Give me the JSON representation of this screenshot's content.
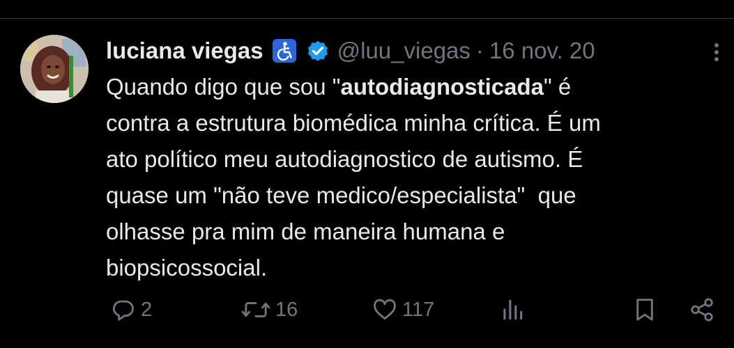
{
  "tweet": {
    "author": {
      "display_name": "luciana viegas",
      "handle": "@luu_viegas",
      "badges": [
        "accessibility-icon",
        "verified-badge-icon"
      ]
    },
    "separator": "·",
    "date": "16 nov. 20",
    "text_lines": [
      {
        "before": "Quando digo que sou \"",
        "bold": "autodiagnosticada",
        "after": "\" é"
      },
      {
        "text": "contra a estrutura biomédica minha crítica. É um"
      },
      {
        "text": "ato político meu autodiagnostico de autismo. É"
      },
      {
        "text": "quase um \"não teve medico/especialista\"  que"
      },
      {
        "text": "olhasse pra mim de maneira humana e"
      },
      {
        "text": "biopsicossocial."
      }
    ]
  },
  "actions": {
    "reply_count": "2",
    "retweet_count": "16",
    "like_count": "117",
    "views_count": ""
  },
  "colors": {
    "background": "#000000",
    "text": "#e7e9ea",
    "muted": "#71767b",
    "verified": "#1d9bf0",
    "accessibility_badge": "#2a66d9"
  }
}
